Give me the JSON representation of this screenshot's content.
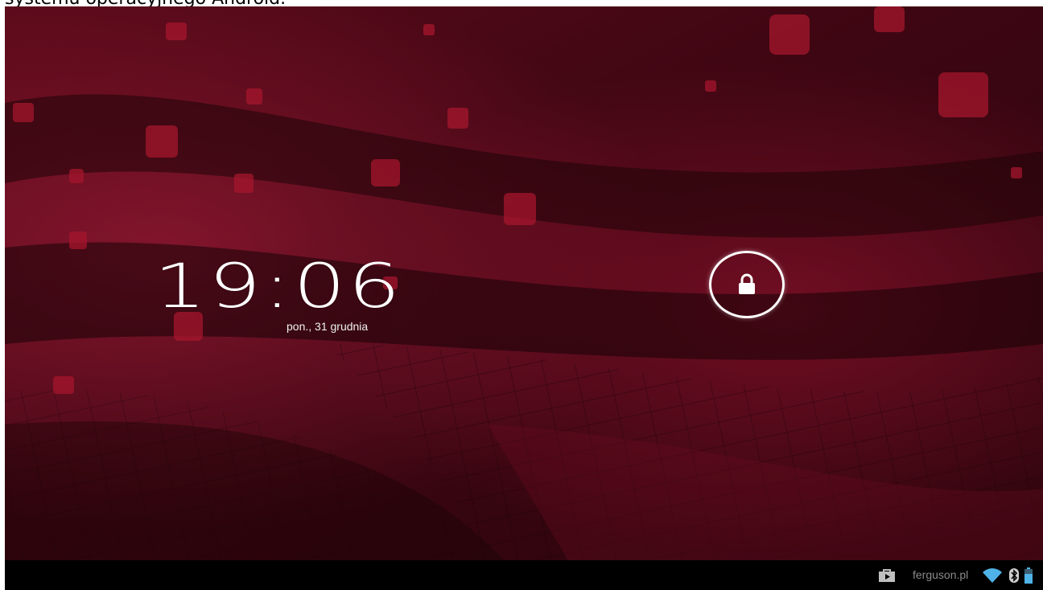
{
  "caption": "systemu operacyjnego Android.",
  "lockscreen": {
    "time": "19:06",
    "date": "pon., 31 grudnia",
    "unlock_icon": "lock-icon"
  },
  "status_bar": {
    "brand": "ferguson.pl",
    "icons": [
      "play-store-icon",
      "wifi-icon",
      "bluetooth-icon",
      "battery-icon"
    ]
  },
  "colors": {
    "wallpaper_base": "#3a0510",
    "wallpaper_accent": "#a0142a",
    "navbar": "#000000",
    "clock_text": "#ffffff",
    "status_icons": "#4fb3e8"
  }
}
